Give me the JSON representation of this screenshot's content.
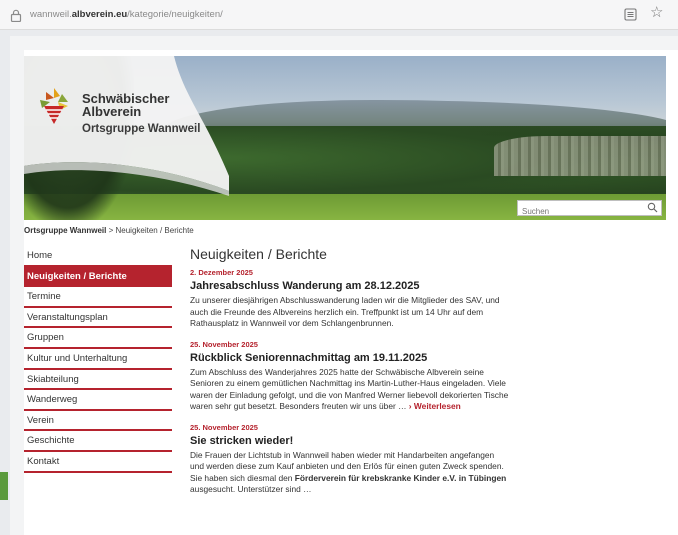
{
  "browser": {
    "url_prefix": "wannweil.",
    "url_domain": "albverein.eu",
    "url_path": "/kategorie/neuigkeiten/"
  },
  "header": {
    "org_line1": "Schwäbischer",
    "org_line2": "Albverein",
    "org_line3": "Ortsgruppe Wannweil",
    "search_placeholder": "Suchen"
  },
  "breadcrumb": {
    "home": "Ortsgruppe Wannweil",
    "sep_current": " > Neuigkeiten / Berichte"
  },
  "sidebar": {
    "items": [
      {
        "label": "Home",
        "active": false
      },
      {
        "label": "Neuigkeiten / Berichte",
        "active": true
      },
      {
        "label": "Termine",
        "active": false
      },
      {
        "label": "Veranstaltungsplan",
        "active": false
      },
      {
        "label": "Gruppen",
        "active": false
      },
      {
        "label": "Kultur und Unterhaltung",
        "active": false
      },
      {
        "label": "Skiabteilung",
        "active": false
      },
      {
        "label": "Wanderweg",
        "active": false
      },
      {
        "label": "Verein",
        "active": false
      },
      {
        "label": "Geschichte",
        "active": false
      },
      {
        "label": "Kontakt",
        "active": false
      }
    ]
  },
  "main": {
    "title": "Neuigkeiten / Berichte",
    "articles": [
      {
        "date": "2. Dezember 2025",
        "title": "Jahresabschluss Wanderung am 28.12.2025",
        "text": "Zu unserer diesjährigen Abschlusswanderung laden wir die Mitglieder des SAV, und auch die Freunde des Albvereins herzlich ein. Treffpunkt ist um 14 Uhr auf dem Rathausplatz in Wannweil vor dem Schlangenbrunnen."
      },
      {
        "date": "25. November 2025",
        "title": "Rückblick Seniorennachmittag am 19.11.2025",
        "text": "Zum Abschluss des Wanderjahres 2025 hatte der Schwäbische Albverein seine Senioren zu einem gemütlichen Nachmittag ins Martin-Luther-Haus eingeladen. Viele waren der Einladung gefolgt, und die von Manfred Werner liebevoll dekorierten Tische waren sehr gut besetzt. Besonders freuten wir uns über …",
        "more": "› Weiterlesen"
      },
      {
        "date": "25. November 2025",
        "title": "Sie stricken wieder!",
        "text_a": "Die Frauen der Lichtstub in Wannweil haben wieder mit Handarbeiten angefangen und werden diese zum Kauf anbieten und den Erlös für einen guten Zweck spenden. Sie haben sich diesmal den ",
        "text_bold": "Förderverein für krebskranke Kinder e.V. in Tübingen",
        "text_b": " ausgesucht. Unterstützer sind …"
      }
    ]
  },
  "colors": {
    "accent": "#b5232e",
    "green": "#5a9a3c"
  }
}
